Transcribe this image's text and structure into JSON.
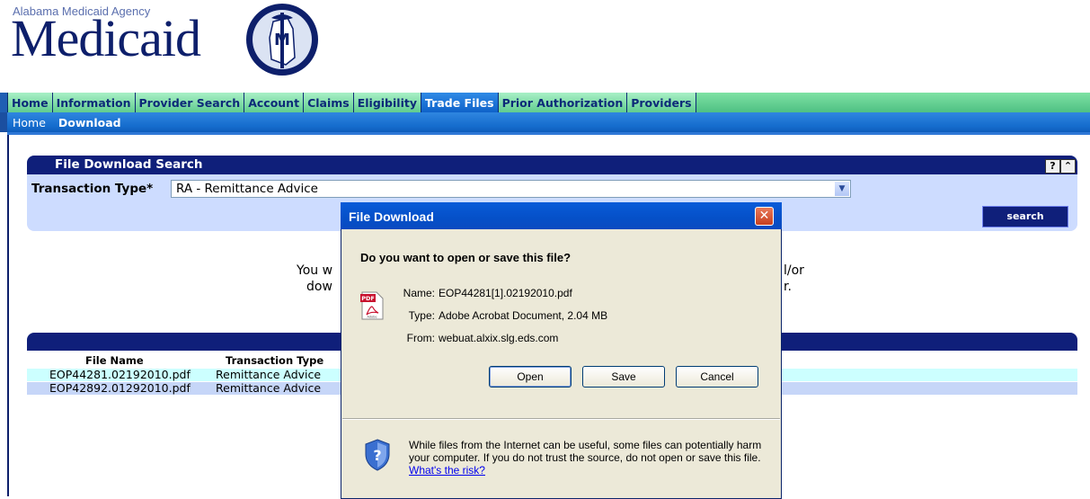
{
  "header": {
    "agency": "Alabama Medicaid Agency",
    "brand": "Medicaid",
    "seal_letter": "M"
  },
  "tabs": [
    "Home",
    "Information",
    "Provider Search",
    "Account",
    "Claims",
    "Eligibility",
    "Trade Files",
    "Prior Authorization",
    "Providers"
  ],
  "active_tab": "Trade Files",
  "subnav": {
    "home": "Home",
    "download": "Download"
  },
  "search": {
    "title": "File Download Search",
    "help_btn": "?",
    "collapse_btn": "≈",
    "transaction_label": "Transaction Type*",
    "transaction_value": "RA - Remittance Advice",
    "search_btn": "search"
  },
  "info": {
    "line1_left": "You w",
    "line1_right": "l/or",
    "line2_left": "dow",
    "line2_right": "r."
  },
  "results": {
    "col_file": "File Name",
    "col_type": "Transaction Type",
    "rows": [
      {
        "file": "EOP44281.02192010.pdf",
        "type": "Remittance Advice"
      },
      {
        "file": "EOP42892.01292010.pdf",
        "type": "Remittance Advice"
      }
    ]
  },
  "dialog": {
    "title": "File Download",
    "close": "✕",
    "question": "Do you want to open or save this file?",
    "name_label": "Name:",
    "name_value": "EOP44281[1].02192010.pdf",
    "type_label": "Type:",
    "type_value": "Adobe Acrobat Document, 2.04 MB",
    "from_label": "From:",
    "from_value": "webuat.alxix.slg.eds.com",
    "open": "Open",
    "save": "Save",
    "cancel": "Cancel",
    "warning": "While files from the Internet can be useful, some files can potentially harm your computer. If you do not trust the source, do not open or save this file.",
    "risk_link": "What's the risk?",
    "pdf_badge": "PDF",
    "pdf_sub": "Adobe"
  },
  "colors": {
    "navy": "#0f1f7a",
    "panel": "#cddcff",
    "row_a": "#ccffff",
    "row_b": "#c6d6f8",
    "dialog_title": "#0a5bd8"
  }
}
